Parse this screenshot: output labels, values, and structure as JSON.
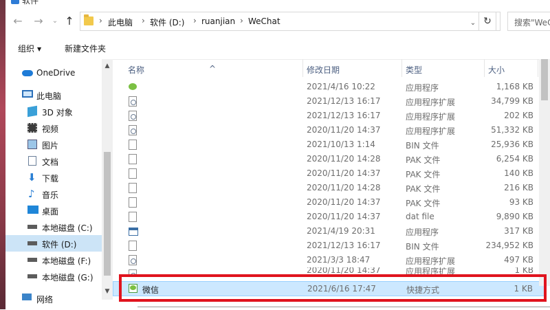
{
  "window": {
    "title": "软件"
  },
  "nav": {
    "back": "←",
    "forward": "→",
    "dropdown": "⌄",
    "up": "↑",
    "refresh": "↻"
  },
  "address": {
    "crumbs": [
      "此电脑",
      "软件 (D:)",
      "ruanjian",
      "WeChat"
    ],
    "separator": "›"
  },
  "search": {
    "placeholder": "搜索\"WeChat\""
  },
  "toolbar": {
    "organize": "组织",
    "new_folder": "新建文件夹"
  },
  "sidebar": {
    "items": [
      {
        "label": "OneDrive",
        "icon": "cloud-icon"
      },
      {
        "label": "此电脑",
        "icon": "computer-icon"
      },
      {
        "label": "3D 对象",
        "icon": "cube-icon"
      },
      {
        "label": "视频",
        "icon": "film-icon"
      },
      {
        "label": "图片",
        "icon": "picture-icon"
      },
      {
        "label": "文档",
        "icon": "document-icon"
      },
      {
        "label": "下载",
        "icon": "download-icon"
      },
      {
        "label": "音乐",
        "icon": "music-icon"
      },
      {
        "label": "桌面",
        "icon": "desktop-icon"
      },
      {
        "label": "本地磁盘 (C:)",
        "icon": "drive-icon"
      },
      {
        "label": "软件 (D:)",
        "icon": "drive-icon",
        "selected": true
      },
      {
        "label": "本地磁盘 (F:)",
        "icon": "drive-icon"
      },
      {
        "label": "本地磁盘 (G:)",
        "icon": "drive-icon"
      },
      {
        "label": "网络",
        "icon": "network-icon"
      }
    ]
  },
  "columns": {
    "name": "名称",
    "date": "修改日期",
    "type": "类型",
    "size": "大小"
  },
  "files": [
    {
      "name": "",
      "date": "2021/4/16 10:22",
      "type": "应用程序",
      "size": "1,168 KB",
      "icon": "wechat-app-icon"
    },
    {
      "name": "",
      "date": "2021/12/13 16:17",
      "type": "应用程序扩展",
      "size": "34,799 KB",
      "icon": "dll-icon"
    },
    {
      "name": "",
      "date": "2021/12/13 16:17",
      "type": "应用程序扩展",
      "size": "202 KB",
      "icon": "dll-icon"
    },
    {
      "name": "",
      "date": "2020/11/20 14:37",
      "type": "应用程序扩展",
      "size": "51,332 KB",
      "icon": "dll-icon"
    },
    {
      "name": "",
      "date": "2021/10/13 1:14",
      "type": "BIN 文件",
      "size": "25,936 KB",
      "icon": "file-icon"
    },
    {
      "name": "",
      "date": "2020/11/20 14:28",
      "type": "PAK 文件",
      "size": "6,254 KB",
      "icon": "file-icon"
    },
    {
      "name": "",
      "date": "2020/11/20 14:37",
      "type": "PAK 文件",
      "size": "140 KB",
      "icon": "file-icon"
    },
    {
      "name": "",
      "date": "2020/11/20 14:28",
      "type": "PAK 文件",
      "size": "216 KB",
      "icon": "file-icon"
    },
    {
      "name": "",
      "date": "2020/11/20 14:37",
      "type": "PAK 文件",
      "size": "93 KB",
      "icon": "file-icon"
    },
    {
      "name": "",
      "date": "2020/11/20 14:37",
      "type": "dat file",
      "size": "9,890 KB",
      "icon": "file-icon"
    },
    {
      "name": "",
      "date": "2021/4/19 20:31",
      "type": "应用程序",
      "size": "317 KB",
      "icon": "app-icon"
    },
    {
      "name": "",
      "date": "2021/12/13 16:17",
      "type": "BIN 文件",
      "size": "234,952 KB",
      "icon": "file-icon"
    },
    {
      "name": "",
      "date": "2021/3/3 18:47",
      "type": "应用程序扩展",
      "size": "497 KB",
      "icon": "dll-icon"
    },
    {
      "name": "",
      "date": "2020/11/20 14:37",
      "type": "应用程序扩展",
      "size": "1 KB",
      "icon": "dll-icon"
    },
    {
      "name": "微信",
      "date": "2021/6/16 17:47",
      "type": "快捷方式",
      "size": "1 KB",
      "icon": "wechat-shortcut-icon",
      "selected": true
    }
  ],
  "colors": {
    "highlight_border": "#e0141e",
    "selection": "#cce8ff",
    "header_text": "#4d6082"
  }
}
